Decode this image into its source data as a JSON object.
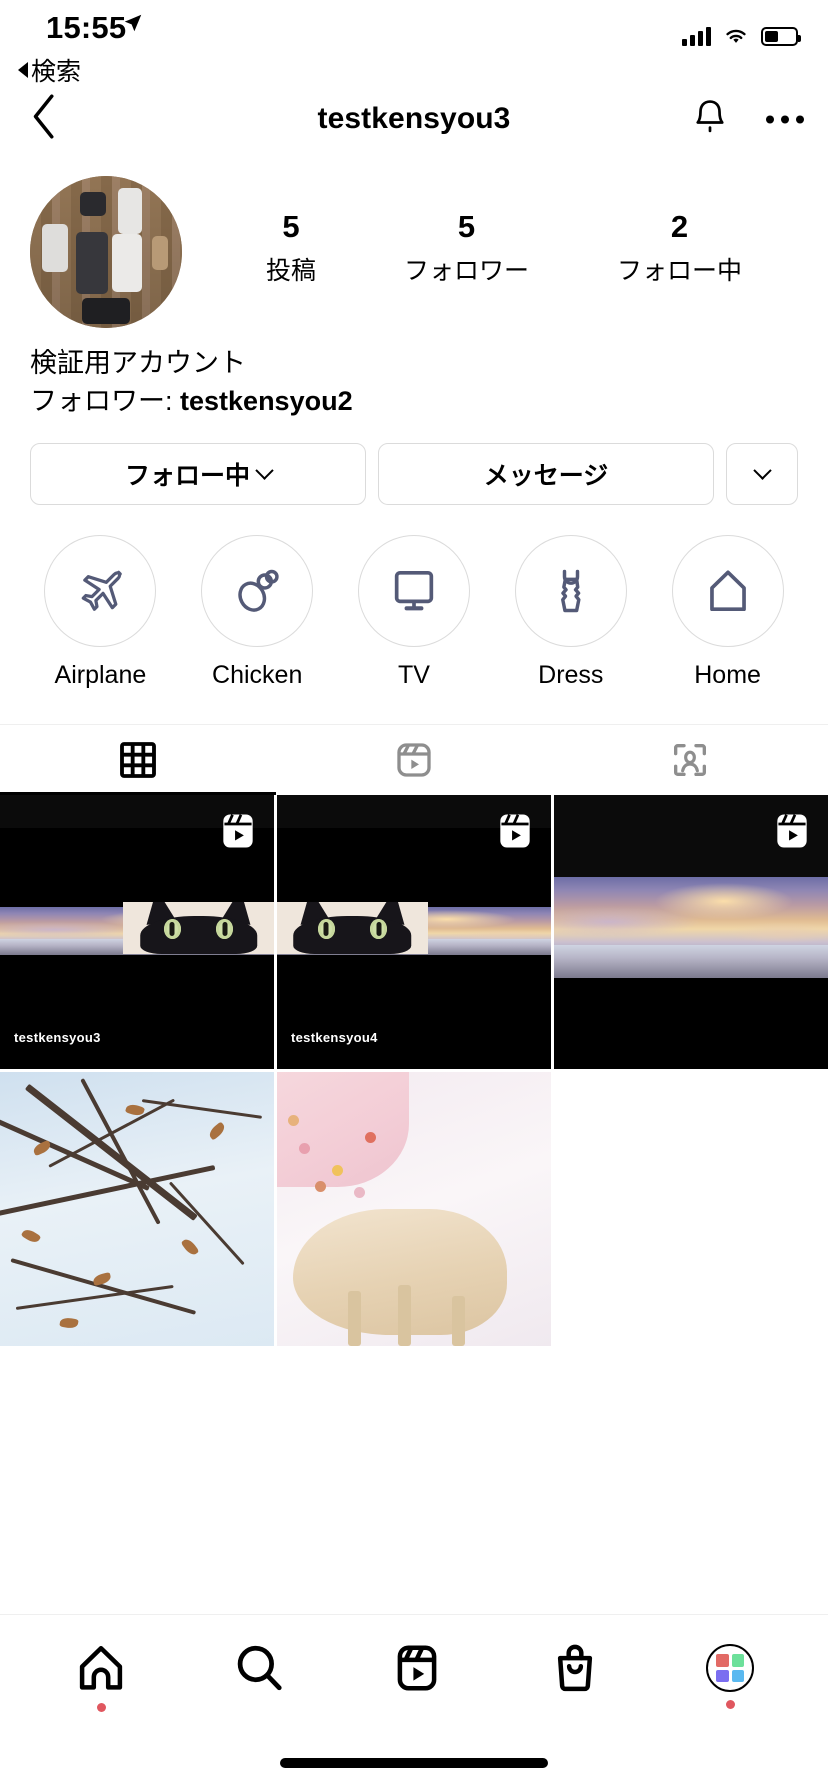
{
  "status_bar": {
    "time": "15:55",
    "location_icon": "location-arrow-icon",
    "back_label": "検索",
    "signal_icon": "cellular-signal-icon",
    "wifi_icon": "wifi-icon",
    "battery_icon": "battery-icon"
  },
  "nav": {
    "back_icon": "chevron-left-icon",
    "title": "testkensyou3",
    "bell_icon": "bell-icon",
    "more_icon": "ellipsis-icon"
  },
  "profile": {
    "avatar_alt": "profile-photo-desk-flatlay",
    "stats": [
      {
        "num": "5",
        "label": "投稿"
      },
      {
        "num": "5",
        "label": "フォロワー"
      },
      {
        "num": "2",
        "label": "フォロー中"
      }
    ],
    "bio_name": "検証用アカウント",
    "bio_followed_prefix": "フォロワー: ",
    "bio_followed_by": "testkensyou2"
  },
  "actions": {
    "following_label": "フォロー中",
    "message_label": "メッセージ",
    "more_icon": "chevron-down-icon",
    "following_chevron_icon": "chevron-down-icon"
  },
  "highlights": [
    {
      "label": "Airplane",
      "icon": "airplane-icon"
    },
    {
      "label": "Chicken",
      "icon": "chicken-drumstick-icon"
    },
    {
      "label": "TV",
      "icon": "tv-monitor-icon"
    },
    {
      "label": "Dress",
      "icon": "dress-icon"
    },
    {
      "label": "Home",
      "icon": "home-icon"
    }
  ],
  "tabs": [
    {
      "name": "grid",
      "icon": "grid-icon",
      "active": true
    },
    {
      "name": "reels",
      "icon": "reels-icon",
      "active": false
    },
    {
      "name": "tagged",
      "icon": "tagged-person-icon",
      "active": false
    }
  ],
  "posts": [
    {
      "type": "reel",
      "kind": "sunset-cat-split",
      "watermark": "testkensyou3",
      "badge": "reels-badge-icon"
    },
    {
      "type": "reel",
      "kind": "cat-sunset-split",
      "watermark": "testkensyou4",
      "badge": "reels-badge-icon"
    },
    {
      "type": "reel",
      "kind": "sunset-sea",
      "watermark": "",
      "badge": "reels-badge-icon"
    },
    {
      "type": "photo",
      "kind": "winter-branches",
      "watermark": "",
      "badge": ""
    },
    {
      "type": "photo",
      "kind": "cat-on-chair",
      "watermark": "",
      "badge": ""
    }
  ],
  "bottom_nav": [
    {
      "name": "home",
      "icon": "home-icon",
      "dot": true
    },
    {
      "name": "search",
      "icon": "search-icon",
      "dot": false
    },
    {
      "name": "reels",
      "icon": "reels-icon",
      "dot": false
    },
    {
      "name": "shop",
      "icon": "shopping-bag-icon",
      "dot": false
    },
    {
      "name": "profile",
      "icon": "profile-avatar-icon",
      "dot": true
    }
  ],
  "colors": {
    "accent_dot": "#e0575f",
    "border": "#dbdbdb",
    "highlight_icon": "#545a77",
    "tab_inactive": "#8e8e8e",
    "avatar_tiles": [
      "#e26a65",
      "#6ce09a",
      "#7b6ef0",
      "#5ab9f0"
    ]
  }
}
